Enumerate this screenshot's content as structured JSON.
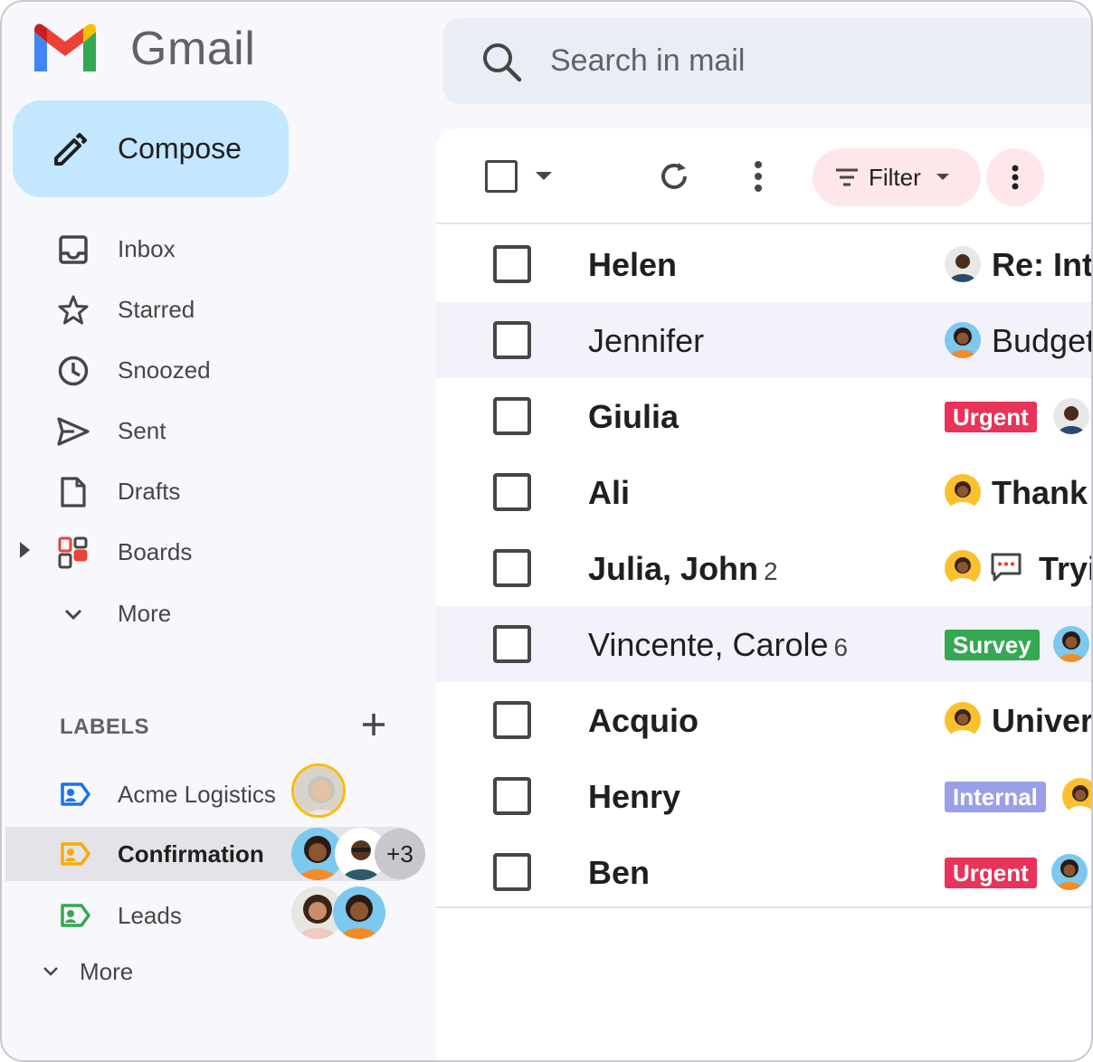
{
  "app": {
    "name": "Gmail"
  },
  "compose": {
    "label": "Compose"
  },
  "search": {
    "placeholder": "Search in mail"
  },
  "nav": [
    {
      "key": "inbox",
      "label": "Inbox",
      "icon": "inbox-icon"
    },
    {
      "key": "starred",
      "label": "Starred",
      "icon": "star-icon"
    },
    {
      "key": "snoozed",
      "label": "Snoozed",
      "icon": "clock-icon"
    },
    {
      "key": "sent",
      "label": "Sent",
      "icon": "send-icon"
    },
    {
      "key": "drafts",
      "label": "Drafts",
      "icon": "draft-icon"
    },
    {
      "key": "boards",
      "label": "Boards",
      "icon": "boards-icon"
    },
    {
      "key": "more",
      "label": "More",
      "icon": "chevron-down-icon"
    }
  ],
  "labels": {
    "heading": "LABELS",
    "items": [
      {
        "label": "Acme Logistics",
        "color": "#1a73e8",
        "members": 1,
        "extra": ""
      },
      {
        "label": "Confirmation",
        "color": "#f9ab00",
        "members": 2,
        "extra": "+3"
      },
      {
        "label": "Leads",
        "color": "#34a853",
        "members": 2,
        "extra": ""
      }
    ],
    "more": "More"
  },
  "toolbar": {
    "filter_label": "Filter"
  },
  "emails": [
    {
      "sender": "Helen",
      "count": "",
      "tag": "",
      "tag_color": "",
      "subject": "Re: Intr",
      "unread": true
    },
    {
      "sender": "Jennifer",
      "count": "",
      "tag": "",
      "tag_color": "",
      "subject": "Budget",
      "unread": false
    },
    {
      "sender": "Giulia",
      "count": "",
      "tag": "Urgent",
      "tag_color": "#e8335a",
      "subject": "",
      "unread": true
    },
    {
      "sender": "Ali",
      "count": "",
      "tag": "",
      "tag_color": "",
      "subject": "Thank",
      "unread": true
    },
    {
      "sender": "Julia, John",
      "count": "2",
      "tag": "",
      "tag_color": "",
      "subject": "Tryi",
      "unread": true
    },
    {
      "sender": "Vincente, Carole",
      "count": "6",
      "tag": "Survey",
      "tag_color": "#34a853",
      "subject": "",
      "unread": false
    },
    {
      "sender": "Acquio",
      "count": "",
      "tag": "",
      "tag_color": "",
      "subject": "Univers",
      "unread": true
    },
    {
      "sender": "Henry",
      "count": "",
      "tag": "Internal",
      "tag_color": "#9aa0e8",
      "subject": "",
      "unread": true
    },
    {
      "sender": "Ben",
      "count": "",
      "tag": "Urgent",
      "tag_color": "#e8335a",
      "subject": "",
      "unread": true
    }
  ]
}
